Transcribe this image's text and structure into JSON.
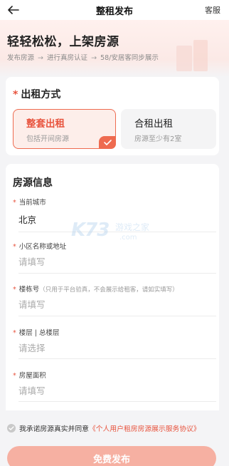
{
  "header": {
    "title": "整租发布",
    "right_label": "客服"
  },
  "hero": {
    "title": "轻轻松松，上架房源",
    "steps": [
      "发布房源",
      "进行真房认证",
      "58/安居客同步展示"
    ]
  },
  "rental_type": {
    "title": "出租方式",
    "required": "*",
    "options": [
      {
        "title": "整套出租",
        "subtitle": "包括开间房源",
        "selected": true
      },
      {
        "title": "合租出租",
        "subtitle": "房源至少有2室",
        "selected": false
      }
    ]
  },
  "house_info": {
    "title": "房源信息",
    "fields": [
      {
        "label": "当前城市",
        "value": "北京"
      },
      {
        "label": "小区名称或地址",
        "placeholder": "请填写"
      },
      {
        "label": "楼栋号",
        "hint": "（只用于平台验真，不会展示给租客，请如实填写）",
        "placeholder": "请填写"
      },
      {
        "label": "楼层 | 总楼层",
        "placeholder": "请选择"
      },
      {
        "label": "房屋面积",
        "placeholder": "请填写"
      }
    ]
  },
  "watermark": {
    "logo": "K73",
    "name": "游戏之家",
    "domain": ".com"
  },
  "agreement": {
    "prefix": "我承诺房源真实并同意",
    "link": "《个人用户租房房源展示服务协议》"
  },
  "submit_label": "免费发布",
  "colors": {
    "accent": "#e8543e",
    "accent_border": "#ee6b50",
    "selected_bg": "#fdeeea",
    "button_disabled": "#f6b0a2"
  }
}
